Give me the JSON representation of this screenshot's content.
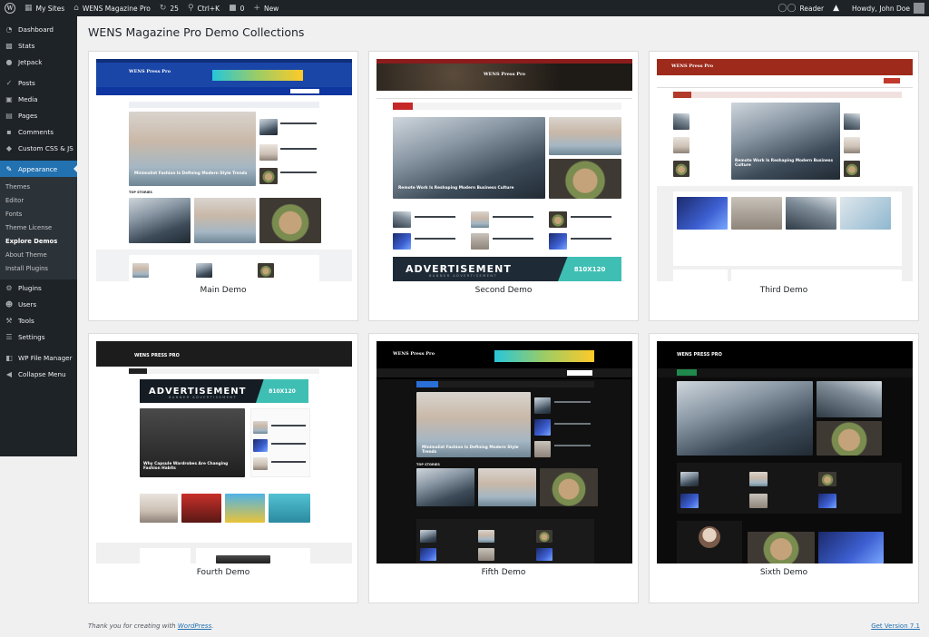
{
  "admin_bar": {
    "my_sites": "My Sites",
    "site_name": "WENS Magazine Pro",
    "updates_count": "25",
    "shortcut": "Ctrl+K",
    "comments_count": "0",
    "new_label": "New",
    "reader_label": "Reader",
    "howdy": "Howdy, John Doe"
  },
  "sidebar": {
    "items_top": [
      {
        "label": "Dashboard",
        "icon": "dashboard-icon"
      },
      {
        "label": "Stats",
        "icon": "stats-icon"
      },
      {
        "label": "Jetpack",
        "icon": "jetpack-icon"
      }
    ],
    "items_mid": [
      {
        "label": "Posts",
        "icon": "posts-icon"
      },
      {
        "label": "Media",
        "icon": "media-icon"
      },
      {
        "label": "Pages",
        "icon": "pages-icon"
      },
      {
        "label": "Comments",
        "icon": "comments-icon"
      },
      {
        "label": "Custom CSS & JS",
        "icon": "code-icon"
      }
    ],
    "appearance": "Appearance",
    "submenu": [
      "Themes",
      "Editor",
      "Fonts",
      "Theme License",
      "Explore Demos",
      "About Theme",
      "Install Plugins"
    ],
    "items_bottom": [
      {
        "label": "Plugins",
        "icon": "plugins-icon"
      },
      {
        "label": "Users",
        "icon": "users-icon"
      },
      {
        "label": "Tools",
        "icon": "tools-icon"
      },
      {
        "label": "Settings",
        "icon": "settings-icon"
      }
    ],
    "file_manager": "WP File Manager",
    "collapse": "Collapse Menu"
  },
  "page": {
    "title": "WENS Magazine Pro Demo Collections"
  },
  "demos": [
    {
      "name": "Main Demo",
      "brand": "WENS Press Pro",
      "headline": "Minimalist Fashion Is Defining Modern Style Trends",
      "section": "TOP STORIES"
    },
    {
      "name": "Second Demo",
      "brand": "WENS Press Pro",
      "headline": "Remote Work Is Reshaping Modern Business Culture",
      "ad": "ADVERTISEMENT",
      "ad_sub": "BANNER ADVERTISEMENT",
      "ad_size": "810X120"
    },
    {
      "name": "Third Demo",
      "brand": "WENS Press Pro",
      "headline": "Remote Work Is Reshaping Modern Business Culture"
    },
    {
      "name": "Fourth Demo",
      "brand": "WENS PRESS PRO",
      "headline": "Why Capsule Wardrobes Are Changing Fashion Habits",
      "ad": "ADVERTISEMENT",
      "ad_sub": "BANNER ADVERTISEMENT",
      "ad_size": "810X120"
    },
    {
      "name": "Fifth Demo",
      "brand": "WENS Press Pro",
      "headline": "Minimalist Fashion Is Defining Modern Style Trends",
      "section": "TOP STORIES"
    },
    {
      "name": "Sixth Demo",
      "brand": "WENS PRESS PRO"
    }
  ],
  "footer": {
    "thanks_prefix": "Thank you for creating with ",
    "wordpress_link": "WordPress",
    "thanks_suffix": ".",
    "version": "Get Version 7.1"
  },
  "colors": {
    "admin_dark": "#1d2327",
    "accent_blue": "#2271b1",
    "demo1_header": "#1a46a8",
    "demo2_header": "#8b1c1c",
    "demo3_header": "#9e2a1b",
    "ad_teal": "#3fbfb4"
  }
}
